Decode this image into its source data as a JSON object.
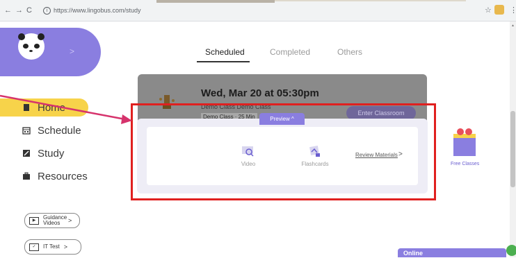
{
  "browser": {
    "back": "←",
    "forward": "→",
    "reload": "C",
    "url": "https://www.lingobus.com/study",
    "star": "☆",
    "menu": "⋮"
  },
  "sidebar": {
    "logo_arrow": ">",
    "items": [
      {
        "label": "Home",
        "icon": "document-icon",
        "active": true
      },
      {
        "label": "Schedule",
        "icon": "calendar-icon"
      },
      {
        "label": "Study",
        "icon": "study-icon"
      },
      {
        "label": "Resources",
        "icon": "briefcase-icon"
      }
    ],
    "guide_button": "Guidance Videos",
    "ittest_button": "IT Test"
  },
  "tabs": [
    "Scheduled",
    "Completed",
    "Others"
  ],
  "class_card": {
    "date": "Wed, Mar 20 at 05:30pm",
    "subtitle": "Demo Class  Demo Class",
    "tag": "Demo Class · 25 Min",
    "enter_button": "Enter Classroom"
  },
  "preview": {
    "tab_label": "Preview ^",
    "video_label": "Video",
    "flashcards_label": "Flashcards",
    "review_link": "Review Materials",
    "review_chevron": ">"
  },
  "free_classes": "Free Classes",
  "chat": {
    "label": "Online"
  },
  "colors": {
    "brand_purple": "#8a7ee0",
    "home_yellow": "#f7d34a",
    "highlight_red": "#e0201f",
    "arrow_pink": "#d6336c"
  }
}
